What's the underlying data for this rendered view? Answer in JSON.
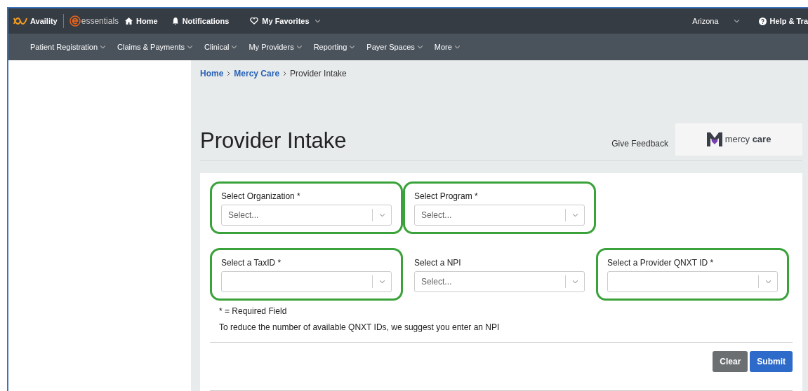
{
  "top_nav": {
    "brand": "Availity",
    "product": "essentials",
    "items": [
      {
        "label": "Home",
        "dropdown": false
      },
      {
        "label": "Notifications",
        "dropdown": false
      },
      {
        "label": "My Favorites",
        "dropdown": true
      }
    ],
    "region": "Arizona",
    "help": "Help & Tra"
  },
  "main_nav": {
    "items": [
      "Patient Registration",
      "Claims & Payments",
      "Clinical",
      "My Providers",
      "Reporting",
      "Payer Spaces",
      "More"
    ]
  },
  "breadcrumb": [
    {
      "label": "Home",
      "link": true
    },
    {
      "label": "Mercy Care",
      "link": true
    },
    {
      "label": "Provider Intake",
      "link": false
    }
  ],
  "page_title": "Provider Intake",
  "feedback": "Give Feedback",
  "payer_logo": {
    "name_light": "mercy",
    "name_bold": "care"
  },
  "form": {
    "rows": [
      [
        {
          "label": "Select Organization *",
          "placeholder": "Select...",
          "highlighted": true
        },
        {
          "label": "Select Program *",
          "placeholder": "Select...",
          "highlighted": true
        }
      ],
      [
        {
          "label": "Select a TaxID *",
          "highlighted": true
        },
        {
          "label": "Select a NPI",
          "placeholder": "Select...",
          "highlighted": false
        },
        {
          "label": "Select a Provider QNXT ID *",
          "highlighted": true
        }
      ]
    ],
    "notes": [
      "* = Required Field",
      "To reduce the number of available QNXT IDs, we suggest you enter an NPI"
    ],
    "buttons": [
      {
        "label": "Clear",
        "kind": "secondary"
      },
      {
        "label": "Submit",
        "kind": "primary"
      }
    ]
  }
}
